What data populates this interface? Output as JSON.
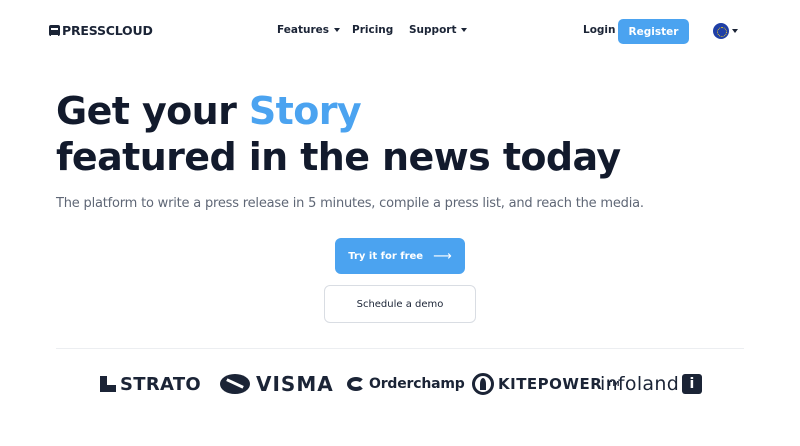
{
  "nav": {
    "logo_text": "PRESSCLOUD",
    "items": [
      {
        "label": "Features",
        "has_dropdown": true
      },
      {
        "label": "Pricing",
        "has_dropdown": false
      },
      {
        "label": "Support",
        "has_dropdown": true
      }
    ],
    "login_label": "Login",
    "register_label": "Register",
    "language_icon": "eu-flag-icon"
  },
  "hero": {
    "title_line1_prefix": "Get your ",
    "title_line1_accent": "Story",
    "title_line2": "featured in the news today",
    "subtitle": "The platform to write a press release in 5 minutes, compile a press list, and reach the media.",
    "cta_label": "Try it for free",
    "cta_arrow": "⟶",
    "demo_label": "Schedule a demo"
  },
  "partners": {
    "strato": "STRATO",
    "visma": "VISMA",
    "orderchamp": "Orderchamp",
    "kitepower": "KITEPOWER",
    "kitepower_tm": "TM",
    "infoland": "infoland",
    "infoland_mark": "i"
  },
  "colors": {
    "accent": "#4ba3f0",
    "text_dark": "#121a2c",
    "text_muted": "#5f6776"
  }
}
